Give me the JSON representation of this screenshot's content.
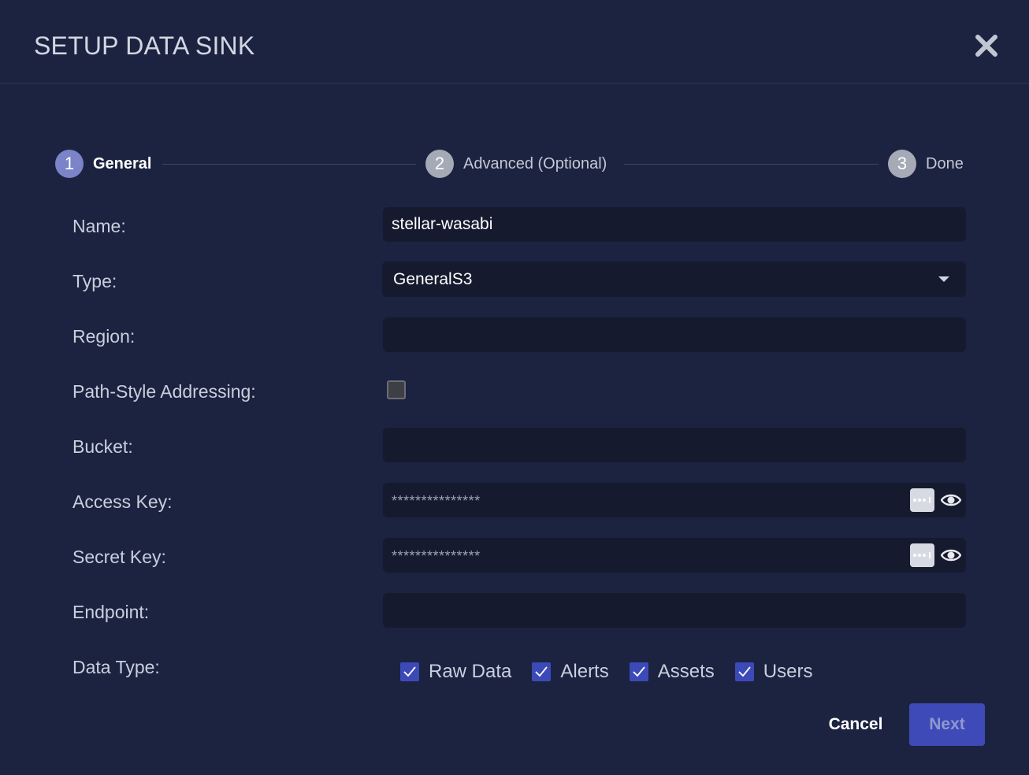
{
  "dialog": {
    "title": "SETUP DATA SINK"
  },
  "stepper": {
    "steps": [
      {
        "number": "1",
        "label": "General",
        "active": true
      },
      {
        "number": "2",
        "label": "Advanced (Optional)",
        "active": false
      },
      {
        "number": "3",
        "label": "Done",
        "active": false
      }
    ]
  },
  "form": {
    "name_label": "Name:",
    "name_value": "stellar-wasabi",
    "type_label": "Type:",
    "type_value": "GeneralS3",
    "region_label": "Region:",
    "region_value": "",
    "path_style_label": "Path-Style Addressing:",
    "path_style_checked": false,
    "bucket_label": "Bucket:",
    "bucket_value": "",
    "access_key_label": "Access Key:",
    "access_key_value": "***************",
    "secret_key_label": "Secret Key:",
    "secret_key_value": "***************",
    "endpoint_label": "Endpoint:",
    "endpoint_value": "",
    "data_type_label": "Data Type:",
    "data_types": [
      {
        "label": "Raw Data",
        "checked": true
      },
      {
        "label": "Alerts",
        "checked": true
      },
      {
        "label": "Assets",
        "checked": true
      },
      {
        "label": "Users",
        "checked": true
      }
    ]
  },
  "footer": {
    "cancel_label": "Cancel",
    "next_label": "Next"
  },
  "icons": {
    "close": "close-icon",
    "dropdown": "chevron-down-icon",
    "keypad": "password-keypad-icon",
    "reveal": "eye-icon",
    "check": "checkmark-icon"
  },
  "colors": {
    "background": "#1c2340",
    "field_background": "#151a2e",
    "accent": "#3d4ab8",
    "active_step": "#7b84c8"
  }
}
